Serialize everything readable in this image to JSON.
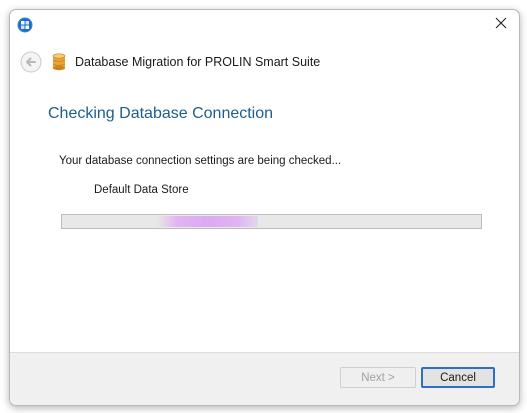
{
  "window": {
    "title": "Database Migration for PROLIN Smart Suite",
    "icons": {
      "app": "prolin-app-icon",
      "close": "close-icon",
      "back": "back-arrow-icon",
      "database": "database-icon"
    }
  },
  "main": {
    "heading": "Checking Database Connection",
    "message": "Your database connection settings are being checked...",
    "store_name": "Default Data Store",
    "progress": {
      "state": "indeterminate",
      "fill_color": "#dca9f2"
    }
  },
  "footer": {
    "next_label": "Next >",
    "cancel_label": "Cancel"
  },
  "colors": {
    "heading": "#1d5e8f",
    "footer_bg": "#f0f0f0",
    "focus_border": "#2f6fbf"
  }
}
